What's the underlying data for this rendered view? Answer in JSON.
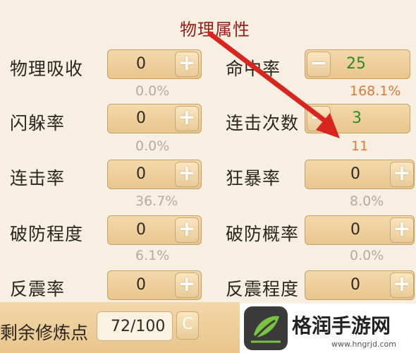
{
  "title": "物理属性",
  "left_stats": [
    {
      "label": "物理吸收",
      "value": "0",
      "percent": "0.0%"
    },
    {
      "label": "闪躲率",
      "value": "0",
      "percent": "0.0%"
    },
    {
      "label": "连击率",
      "value": "0",
      "percent": "36.7%"
    },
    {
      "label": "破防程度",
      "value": "0",
      "percent": "6.1%"
    },
    {
      "label": "反震率",
      "value": "0",
      "percent": ""
    }
  ],
  "right_stats": [
    {
      "label": "命中率",
      "value": "25",
      "percent": "168.1%"
    },
    {
      "label": "连击次数",
      "value": "3",
      "percent": "11"
    },
    {
      "label": "狂暴率",
      "value": "0",
      "percent": "8.0%"
    },
    {
      "label": "破防概率",
      "value": "0",
      "percent": "0.0%"
    },
    {
      "label": "反震程度",
      "value": "0",
      "percent": ""
    }
  ],
  "buttons": {
    "plus": "+",
    "minus": "−",
    "refresh": "C"
  },
  "bottom": {
    "label": "剩余修炼点",
    "points": "72/100"
  },
  "watermark": {
    "site": "格润手游网",
    "url": "www.hngrjd.com"
  },
  "colors": {
    "title": "#9a1c18",
    "green_value": "#2f8a2c",
    "orange_percent": "#e0793b",
    "arrow": "#d8261e"
  },
  "icons": {
    "plus": "plus-icon",
    "minus": "minus-icon",
    "refresh": "refresh-icon",
    "arrow": "red-arrow-annotation"
  }
}
